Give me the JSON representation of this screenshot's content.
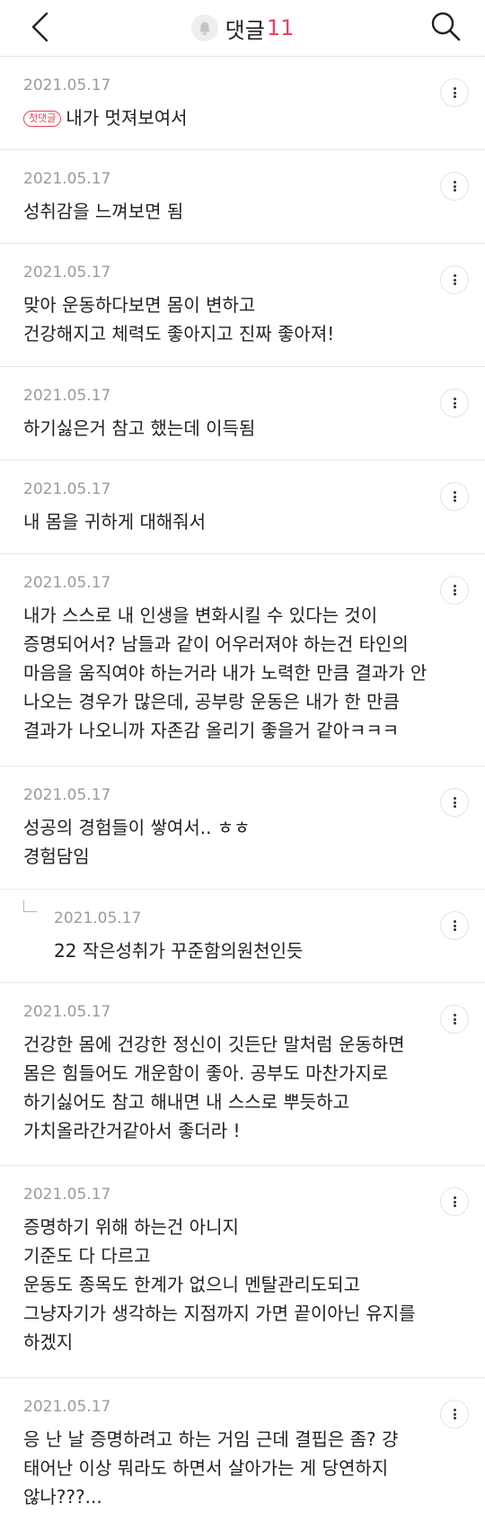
{
  "header": {
    "title": "댓글",
    "count": "11",
    "icons": {
      "back": "chevron-left-icon",
      "bell": "bell-icon",
      "search": "search-icon"
    }
  },
  "badge_label": "첫댓글",
  "comments": [
    {
      "date": "2021.05.17",
      "lines": [
        "내가 멋져보여서"
      ]
    },
    {
      "date": "2021.05.17",
      "lines": [
        "성취감을 느껴보면 됨"
      ]
    },
    {
      "date": "2021.05.17",
      "lines": [
        "맞아 운동하다보면 몸이 변하고",
        "건강해지고 체력도 좋아지고 진짜 좋아져!"
      ]
    },
    {
      "date": "2021.05.17",
      "lines": [
        "하기싫은거 참고 했는데 이득됨"
      ]
    },
    {
      "date": "2021.05.17",
      "lines": [
        "내 몸을 귀하게 대해줘서"
      ]
    },
    {
      "date": "2021.05.17",
      "lines": [
        "내가 스스로 내 인생을 변화시킬 수 있다는 것이",
        "증명되어서? 남들과 같이 어우러져야 하는건 타인의",
        "마음을 움직여야 하는거라 내가 노력한 만큼 결과가 안",
        "나오는 경우가 많은데, 공부랑 운동은 내가 한 만큼",
        "결과가 나오니까 자존감 올리기 좋을거 같아ㅋㅋㅋ"
      ]
    },
    {
      "date": "2021.05.17",
      "lines": [
        "성공의 경험들이 쌓여서.. ㅎㅎ",
        "경험담임"
      ]
    },
    {
      "date": "2021.05.17",
      "lines": [
        "22 작은성취가 꾸준함의원천인듯"
      ]
    },
    {
      "date": "2021.05.17",
      "lines": [
        "건강한 몸에 건강한 정신이 깃든단 말처럼 운동하면",
        "몸은 힘들어도 개운함이 좋아. 공부도 마찬가지로",
        "하기싫어도 참고 해내면 내 스스로 뿌듯하고",
        "가치올라간거같아서 좋더라 !"
      ]
    },
    {
      "date": "2021.05.17",
      "lines": [
        "증명하기 위해 하는건 아니지",
        "기준도 다 다르고",
        "운동도 종목도 한계가 없으니 멘탈관리도되고",
        "그냥자기가 생각하는 지점까지 가면 끝이아닌 유지를",
        "하겠지"
      ]
    },
    {
      "date": "2021.05.17",
      "lines": [
        "응 난 날 증명하려고 하는 거임 근데 결핍은 좀? 걍",
        "태어난 이상 뭐라도 하면서 살아가는 게 당연하지",
        "않나???..."
      ]
    }
  ]
}
